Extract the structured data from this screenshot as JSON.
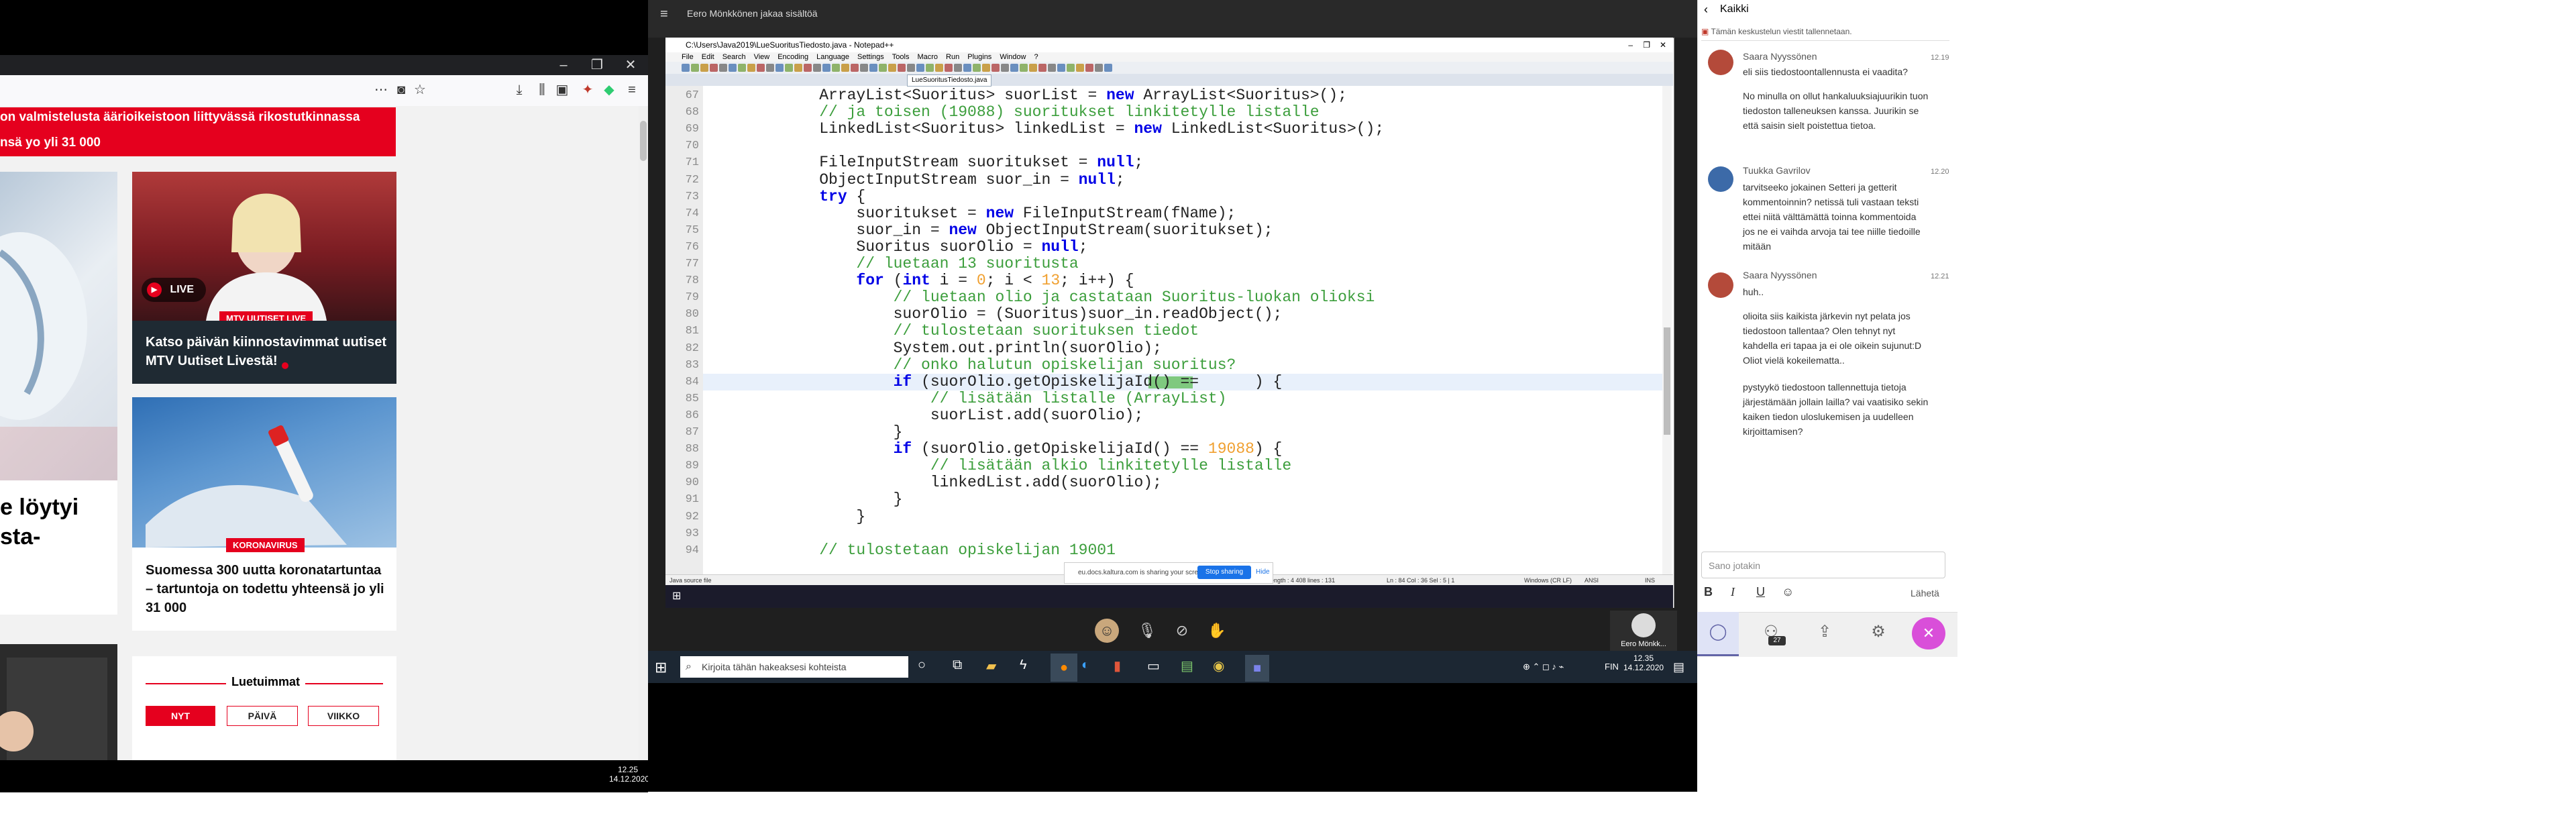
{
  "browser": {
    "headline_bar": "on valmistelusta äärioikeistoon liittyvässä rikostutkinnassa",
    "headline_bar2": "nsä yo yli 31 000",
    "left_title": "e löytyi\nsta-",
    "cards": [
      {
        "badge": "MTV UUTISET LIVE",
        "live_label": "LIVE",
        "title": "Katso päivän kiinnostavimmat uutiset MTV Uutiset Livestä!"
      },
      {
        "badge": "KORONAVIRUS",
        "title": "Suomessa 300 uutta koronatartuntaa – tartuntoja on todettu yhteensä jo yli 31 000"
      }
    ],
    "most_read": {
      "title": "Luetuimmat",
      "tabs": [
        "NYT",
        "PÄIVÄ",
        "VIIKKO"
      ]
    },
    "clock_time": "12.25",
    "clock_date": "14.12.2020"
  },
  "meeting": {
    "header_text": "Eero Mönkkönen jakaa sisältöä",
    "presenter_name": "Eero Mönkk...",
    "taskbar_search": "Kirjoita tähän hakeaksesi kohteista",
    "clock_time": "12.35",
    "clock_date": "14.12.2020",
    "lang": "FIN"
  },
  "editor": {
    "title": "C:\\Users\\Java2019\\LueSuoritusTiedosto.java - Notepad++",
    "menu": [
      "File",
      "Edit",
      "Search",
      "View",
      "Encoding",
      "Language",
      "Settings",
      "Tools",
      "Macro",
      "Run",
      "Plugins",
      "Window",
      "?"
    ],
    "active_tab": "LueSuoritusTiedosto.java",
    "share_text": "eu.docs.kaltura.com is sharing your screen.",
    "stop_label": "Stop sharing",
    "hide_label": "Hide",
    "status_left": "Java source file",
    "status_mid": "length : 4 408    lines : 131",
    "status_pos": "Ln : 84    Col : 36    Sel : 5 | 1",
    "status_eol": "Windows (CR LF)",
    "status_enc": "ANSI",
    "status_ins": "INS",
    "lines": [
      {
        "n": "67",
        "segs": [
          [
            "",
            "    ArrayList<Suoritus> suorList = "
          ],
          [
            "kw",
            "new"
          ],
          [
            "",
            " ArrayList<Suoritus>();"
          ]
        ]
      },
      {
        "n": "68",
        "segs": [
          [
            "cm",
            "    // ja toisen (19088) suoritukset linkitetylle listalle"
          ]
        ]
      },
      {
        "n": "69",
        "segs": [
          [
            "",
            "    LinkedList<Suoritus> linkedList = "
          ],
          [
            "kw",
            "new"
          ],
          [
            "",
            " LinkedList<Suoritus>();"
          ]
        ]
      },
      {
        "n": "70",
        "segs": [
          [
            "",
            ""
          ]
        ]
      },
      {
        "n": "71",
        "segs": [
          [
            "",
            "    FileInputStream suoritukset = "
          ],
          [
            "kw",
            "null"
          ],
          [
            "",
            ";"
          ]
        ]
      },
      {
        "n": "72",
        "segs": [
          [
            "",
            "    ObjectInputStream suor_in = "
          ],
          [
            "kw",
            "null"
          ],
          [
            "",
            ";"
          ]
        ]
      },
      {
        "n": "73",
        "segs": [
          [
            "kw",
            "    try"
          ],
          [
            "",
            " {"
          ]
        ]
      },
      {
        "n": "74",
        "segs": [
          [
            "",
            "        suoritukset = "
          ],
          [
            "kw",
            "new"
          ],
          [
            "",
            " FileInputStream(fName);"
          ]
        ]
      },
      {
        "n": "75",
        "segs": [
          [
            "",
            "        suor_in = "
          ],
          [
            "kw",
            "new"
          ],
          [
            "",
            " ObjectInputStream(suoritukset);"
          ]
        ]
      },
      {
        "n": "76",
        "segs": [
          [
            "",
            "        Suoritus suorOlio = "
          ],
          [
            "kw",
            "null"
          ],
          [
            "",
            ";"
          ]
        ]
      },
      {
        "n": "77",
        "segs": [
          [
            "cm",
            "        // luetaan 13 suoritusta"
          ]
        ]
      },
      {
        "n": "78",
        "segs": [
          [
            "kw",
            "        for"
          ],
          [
            "",
            " ("
          ],
          [
            "kw",
            "int"
          ],
          [
            "",
            " i = "
          ],
          [
            "num",
            "0"
          ],
          [
            "",
            "; i < "
          ],
          [
            "num",
            "13"
          ],
          [
            "",
            "; i++) {"
          ]
        ]
      },
      {
        "n": "79",
        "segs": [
          [
            "cm",
            "            // luetaan olio ja castataan Suoritus-luokan olioksi"
          ]
        ]
      },
      {
        "n": "80",
        "segs": [
          [
            "",
            "            suorOlio = (Suoritus)suor_in.readObject();"
          ]
        ]
      },
      {
        "n": "81",
        "segs": [
          [
            "cm",
            "            // tulostetaan suorituksen tiedot"
          ]
        ]
      },
      {
        "n": "82",
        "segs": [
          [
            "",
            "            System.out.println(suorOlio);"
          ]
        ]
      },
      {
        "n": "83",
        "segs": [
          [
            "cm",
            "            // onko halutun opiskelijan suoritus?"
          ]
        ]
      },
      {
        "n": "84",
        "segs": [
          [
            "kw",
            "            if"
          ],
          [
            "",
            " (suorOlio.getOpiskelijaId() == "
          ],
          [
            "num",
            "     "
          ],
          [
            "",
            ") {"
          ]
        ]
      },
      {
        "n": "85",
        "segs": [
          [
            "cm",
            "                // lisätään listalle (ArrayList)"
          ]
        ]
      },
      {
        "n": "86",
        "segs": [
          [
            "",
            "                suorList.add(suorOlio);"
          ]
        ]
      },
      {
        "n": "87",
        "segs": [
          [
            "",
            "            }"
          ]
        ]
      },
      {
        "n": "88",
        "segs": [
          [
            "kw",
            "            if"
          ],
          [
            "",
            " (suorOlio.getOpiskelijaId() == "
          ],
          [
            "num",
            "19088"
          ],
          [
            "",
            ") {"
          ]
        ]
      },
      {
        "n": "89",
        "segs": [
          [
            "cm",
            "                // lisätään alkio linkitetylle listalle"
          ]
        ]
      },
      {
        "n": "90",
        "segs": [
          [
            "",
            "                linkedList.add(suorOlio);"
          ]
        ]
      },
      {
        "n": "91",
        "segs": [
          [
            "",
            "            }"
          ]
        ]
      },
      {
        "n": "92",
        "segs": [
          [
            "",
            "        }"
          ]
        ]
      },
      {
        "n": "93",
        "segs": [
          [
            "",
            ""
          ]
        ]
      },
      {
        "n": "94",
        "segs": [
          [
            "cm",
            "    // tulostetaan opiskelijan 19001"
          ]
        ]
      }
    ]
  },
  "chat": {
    "back_label": "Kaikki",
    "notice": "Tämän keskustelun viestit tallennetaan.",
    "messages": [
      {
        "name": "Saara Nyyssönen",
        "time": "12.19",
        "paragraphs": [
          "eli siis tiedostoontallennusta ei vaadita?",
          "No minulla on ollut hankaluuksiajuurikin tuon tiedoston talleneuksen kanssa. Juurikin se että saisin sielt poistettua tietoa."
        ]
      },
      {
        "name": "Tuukka Gavrilov",
        "time": "12.20",
        "paragraphs": [
          "tarvitseeko jokainen Setteri ja getterit kommentoinnin? netissä tuli vastaan teksti ettei niitä välttämättä toinna kommentoida jos ne ei vaihda arvoja tai tee niille tiedoille mitään"
        ]
      },
      {
        "name": "Saara Nyyssönen",
        "time": "12.21",
        "paragraphs": [
          "huh..",
          "olioita siis kaikista järkevin nyt pelata jos tiedostoon tallentaa? Olen tehnyt nyt kahdella eri tapaa ja ei ole oikein sujunut:D Oliot vielä kokeilematta..",
          "pystyykö tiedostoon tallennettuja tietoja järjestämään jollain lailla? vai vaatisiko sekin kaiken tiedon uloslukemisen ja uudelleen kirjoittamisen?"
        ]
      }
    ],
    "input_placeholder": "Sano jotakin",
    "send_label": "Lähetä",
    "participants_count": "27"
  }
}
